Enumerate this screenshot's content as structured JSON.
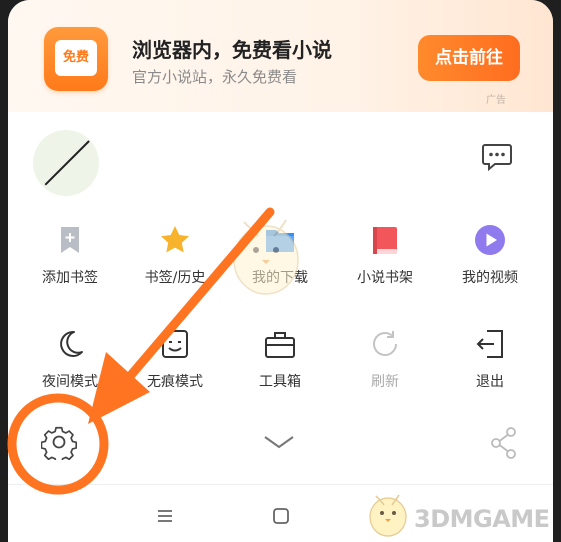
{
  "banner": {
    "icon_label": "免费",
    "title": "浏览器内，免费看小说",
    "subtitle": "官方小说站，永久免费看",
    "button": "点击前往",
    "ad_tag": "广告"
  },
  "header": {
    "avatar": "avatar",
    "message_icon": "message-icon"
  },
  "grid_row1": [
    {
      "label": "添加书签",
      "icon": "bookmark-add-icon"
    },
    {
      "label": "书签/历史",
      "icon": "star-icon"
    },
    {
      "label": "我的下载",
      "icon": "folder-icon"
    },
    {
      "label": "小说书架",
      "icon": "book-icon"
    },
    {
      "label": "我的视频",
      "icon": "video-play-icon"
    }
  ],
  "grid_row2": [
    {
      "label": "夜间模式",
      "icon": "moon-icon"
    },
    {
      "label": "无痕模式",
      "icon": "incognito-icon"
    },
    {
      "label": "工具箱",
      "icon": "toolbox-icon"
    },
    {
      "label": "刷新",
      "icon": "refresh-icon"
    },
    {
      "label": "退出",
      "icon": "exit-icon"
    }
  ],
  "watermark": "3DMGAME",
  "colors": {
    "accent": "#ff7a1a",
    "annotation": "#ff7420",
    "text": "#333333"
  }
}
